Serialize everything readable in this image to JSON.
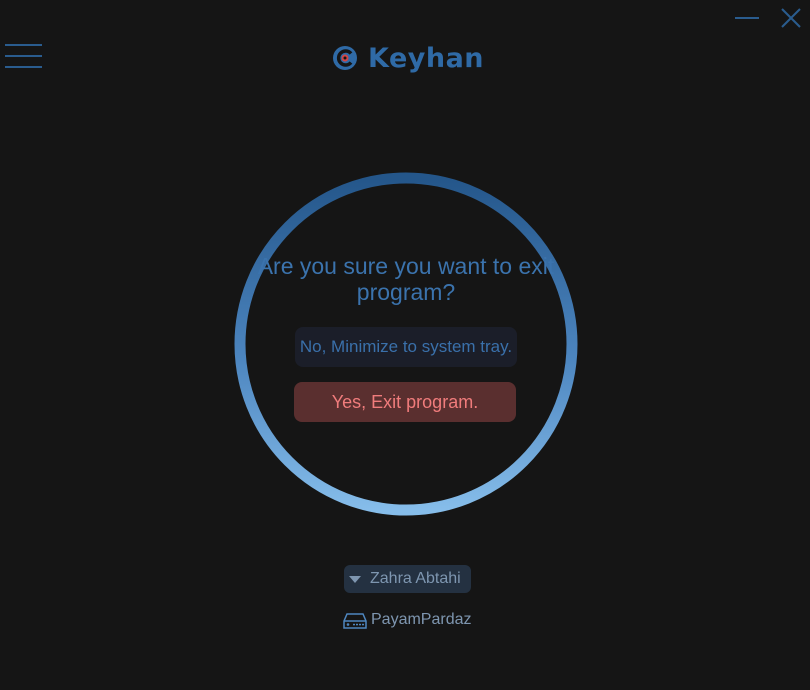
{
  "header": {
    "app_name": "Keyhan",
    "menu_icon": "hamburger-menu-icon",
    "logo_icon": "keyhan-logo-icon",
    "minimize_icon": "minimize-icon",
    "close_icon": "close-icon"
  },
  "dialog": {
    "question": "Are you sure you want to exit program?",
    "minimize_label": "No, Minimize to system tray.",
    "exit_label": "Yes, Exit program."
  },
  "footer": {
    "user_name": "Zahra Abtahi",
    "user_icon": "caret-down-icon",
    "company_name": "PayamPardaz",
    "company_icon": "device-icon"
  },
  "colors": {
    "background": "#151515",
    "accent": "#2f6aa6",
    "ring_top": "#2a5a8c",
    "ring_bottom": "#7fb6e6",
    "exit_bg": "#5a2f2f",
    "exit_text": "#f07c7c"
  }
}
